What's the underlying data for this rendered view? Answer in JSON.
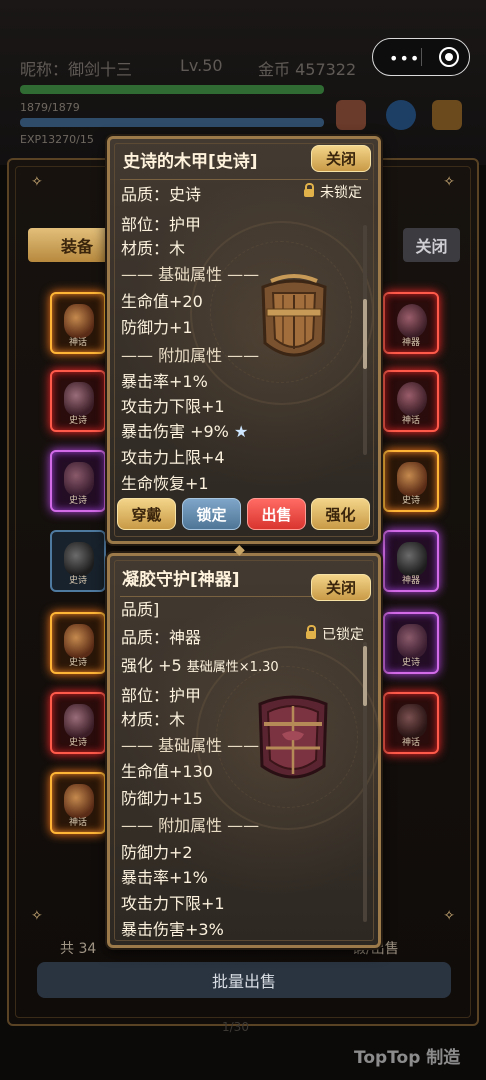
{
  "header": {
    "nickname": "昵称：御剑十三",
    "level": "Lv.50",
    "gold": "金币 457322",
    "hp_text": "1879/1879",
    "exp_text": "EXP13270/15",
    "capsule_dots": "•••"
  },
  "bag": {
    "tab_equip": "装备",
    "close_label": "关闭",
    "count_prefix": "共 34",
    "count_suffix": "锻/出售",
    "bulk_sell": "批量出售",
    "page": "1/30",
    "slot_labels": [
      "神话",
      "史诗",
      "史诗",
      "史诗",
      "史诗",
      "史诗",
      "神话",
      "神器",
      "神话",
      "史诗",
      "神器",
      "史诗",
      "神话"
    ]
  },
  "popup1": {
    "title": "史诗的木甲[史诗]",
    "close": "关闭",
    "quality": "品质：史诗",
    "lock": "未锁定",
    "slot": "部位：护甲",
    "material": "材质：木",
    "base_header": "—— 基础属性 ——",
    "base": [
      "生命值+20",
      "防御力+1"
    ],
    "extra_header": "—— 附加属性 ——",
    "extra": [
      "暴击率+1%",
      "攻击力下限+1",
      "暴击伤害 +9%",
      "攻击力上限+4",
      "生命恢复+1"
    ],
    "star": "★",
    "actions": [
      "穿戴",
      "锁定",
      "出售",
      "强化"
    ]
  },
  "popup2": {
    "title": "凝胶守护[神器]",
    "close": "关闭",
    "quality_header": "品质]",
    "quality": "品质：神器",
    "lock": "已锁定",
    "enhance": "强化 +5",
    "enhance_note": "基础属性×1.30",
    "slot": "部位：护甲",
    "material": "材质：木",
    "base_header": "—— 基础属性 ——",
    "base": [
      "生命值+130",
      "防御力+15"
    ],
    "extra_header": "—— 附加属性 ——",
    "extra": [
      "防御力+2",
      "暴击率+1%",
      "攻击力下限+1",
      "暴击伤害+3%"
    ]
  },
  "watermark": "TopTop 制造",
  "colors": {
    "gold_button": "#e0b767",
    "sell_button": "#e8433d",
    "lock_button": "#6a90b2",
    "panel_border": "#9c7a49"
  }
}
